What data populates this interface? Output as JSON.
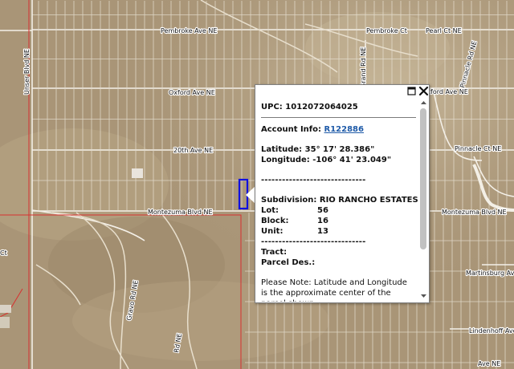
{
  "map": {
    "street_labels": [
      "Pembroke Ave NE",
      "Pembroke Ct",
      "Pearl Ct NE",
      "Oxford Ave NE",
      "Oxford Ave NE",
      "20th Ave NE",
      "Montezuma Blvd NE",
      "Montezuma Blvd NE",
      "Unser Blvd NE",
      "Grand Rd NE",
      "Gravo Rd NE",
      "Pinnacle Rd NE",
      "Pinnacle Ct NE",
      "Martinsburg Ave",
      "Lindenhoff Ave",
      "Rd NE",
      "Ave NE",
      "Ct"
    ]
  },
  "popup": {
    "upc_label": "UPC:",
    "upc_value": "1012072064025",
    "account_label": "Account Info:",
    "account_link": "R122886",
    "latitude_label": "Latitude:",
    "latitude_value": "35° 17' 28.386\"",
    "longitude_label": "Longitude:",
    "longitude_value": "-106° 41' 23.049\"",
    "divider": "------------------------------",
    "subdivision_label": "Subdivision:",
    "subdivision_value": "RIO RANCHO ESTATES",
    "lot_label": "Lot:",
    "lot_value": "56",
    "block_label": "Block:",
    "block_value": "16",
    "unit_label": "Unit:",
    "unit_value": "13",
    "tract_label": "Tract:",
    "parcel_label": "Parcel Des.:",
    "note": "Please Note: Latitude and Longitude is the approximate center of the parcel shown."
  },
  "icons": {
    "maximize": "maximize-icon",
    "close": "close-icon",
    "scroll_up": "arrow-up-icon",
    "scroll_down": "arrow-down-icon"
  },
  "colors": {
    "parcel_outline": "#1010e0",
    "link": "#1e5aa8",
    "boundary": "#d83030"
  }
}
